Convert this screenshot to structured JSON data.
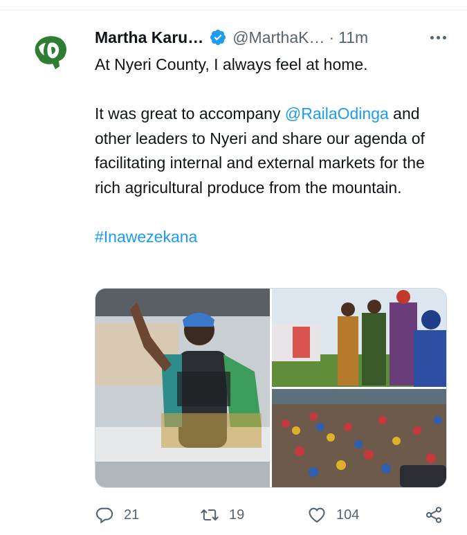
{
  "tweet": {
    "author": {
      "display_name": "Martha Karu…",
      "handle": "@MarthaK…",
      "verified": true,
      "avatar_icon": "green-profile-silhouette-logo"
    },
    "separator": "·",
    "timestamp": "11m",
    "text": {
      "line1": "At Nyeri County, I always feel at home.",
      "p2_before": "It was great to accompany ",
      "mention": "@RailaOdinga",
      "p2_after": " and other leaders to Nyeri and share our agenda of facilitating internal and external markets for the rich agricultural produce from the mountain.",
      "hashtag": "#Inawezekana"
    },
    "media": {
      "count": 3,
      "photos": [
        {
          "subject": "woman in blue cap waving from vehicle"
        },
        {
          "subject": "leaders walking outdoors on grass"
        },
        {
          "subject": "large crowd gathered"
        }
      ]
    },
    "actions": {
      "replies": "21",
      "retweets": "19",
      "likes": "104"
    },
    "colors": {
      "link": "#1d9bf0",
      "verified": "#1d9bf0",
      "muted": "#536471",
      "avatar_green": "#2e7d32"
    }
  }
}
